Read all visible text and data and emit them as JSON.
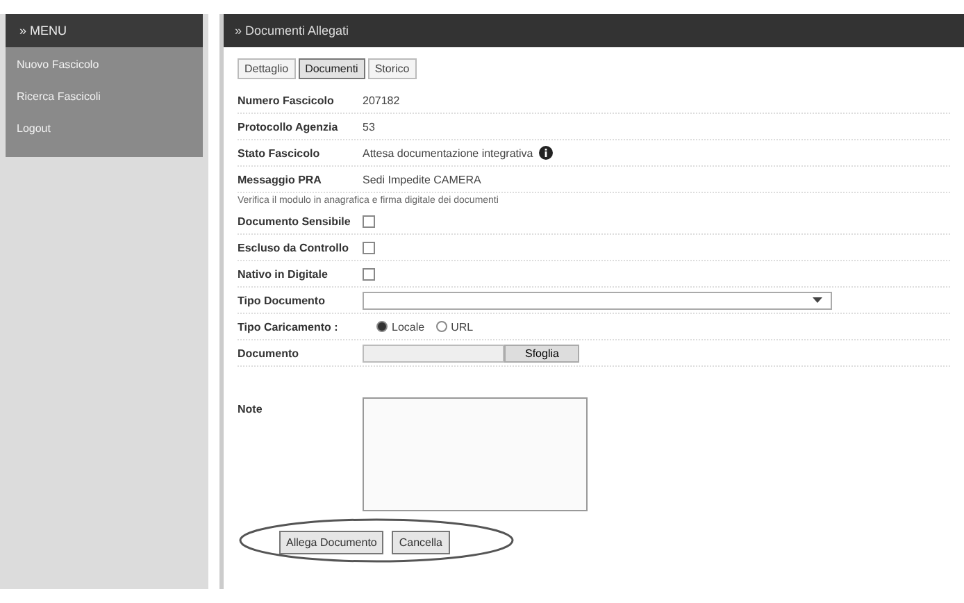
{
  "sidebar": {
    "title": "» MENU",
    "items": [
      {
        "label": "Nuovo Fascicolo",
        "selected": false
      },
      {
        "label": "Ricerca Fascicoli",
        "selected": false
      },
      {
        "label": "Logout",
        "selected": false
      }
    ]
  },
  "main": {
    "title": "» Documenti Allegati",
    "tabs": [
      {
        "label": "Dettaglio",
        "selected": false
      },
      {
        "label": "Documenti",
        "selected": true
      },
      {
        "label": "Storico",
        "selected": false
      }
    ],
    "fields": [
      {
        "kind": "text",
        "label": "Numero Fascicolo",
        "value": "207182"
      },
      {
        "kind": "text",
        "label": "Protocollo Agenzia",
        "value": "53"
      },
      {
        "kind": "status",
        "label": "Stato Fascicolo",
        "value": "Attesa documentazione integrativa"
      },
      {
        "kind": "text",
        "label": "Messaggio PRA",
        "value": "Sedi Impedite CAMERA"
      },
      {
        "kind": "note",
        "value": "Verifica il modulo in anagrafica e firma digitale dei documenti"
      },
      {
        "kind": "checkbox",
        "label": "Documento Sensibile",
        "checked": false
      },
      {
        "kind": "checkbox",
        "label": "Escluso da Controllo",
        "checked": false
      },
      {
        "kind": "checkbox",
        "label": "Nativo in Digitale",
        "checked": false
      },
      {
        "kind": "select",
        "label": "Tipo Documento"
      },
      {
        "kind": "radio",
        "label": "Tipo Caricamento :",
        "options": [
          {
            "label": "Locale",
            "selected": true
          },
          {
            "label": "URL",
            "selected": false
          }
        ]
      },
      {
        "kind": "file",
        "label": "Documento",
        "button": "Sfoglia"
      },
      {
        "kind": "textarea",
        "label": "Note"
      }
    ],
    "buttons": [
      "Allega Documento",
      "Cancella"
    ]
  }
}
